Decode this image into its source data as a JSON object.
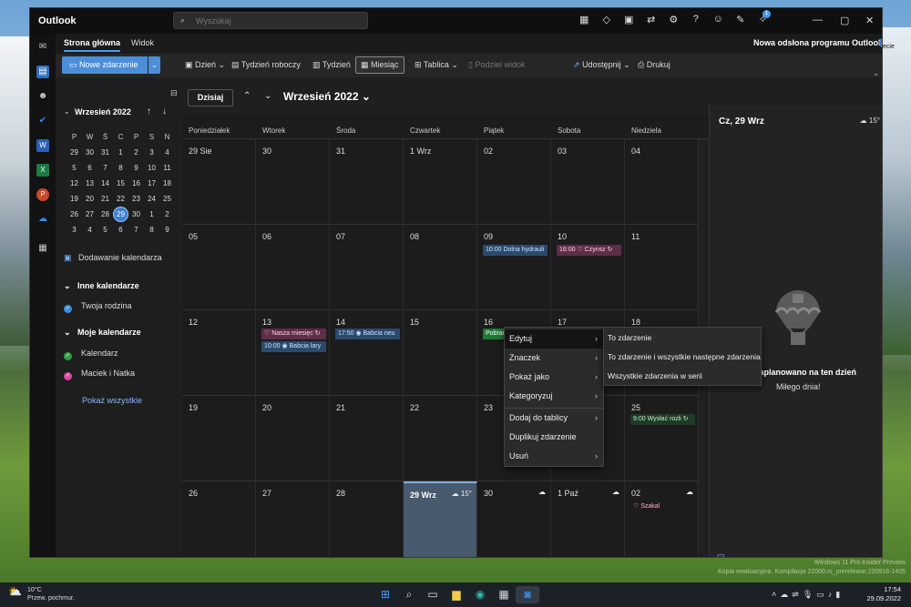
{
  "window": {
    "title": "Outlook"
  },
  "search": {
    "placeholder": "Wyszukaj",
    "icon": "search-icon"
  },
  "titlebar": {
    "badge": "1"
  },
  "ribbon": {
    "tabs": [
      "Strona główna",
      "Widok"
    ],
    "new_outlook_label": "Nowa odsłona programu Outlook",
    "edge_text": "ecie"
  },
  "toolbar": {
    "new_event": "Nowe zdarzenie",
    "day": "Dzień",
    "work_week": "Tydzień roboczy",
    "week": "Tydzień",
    "month": "Miesiąc",
    "board": "Tablica",
    "split": "Podziel widok",
    "share": "Udostępnij",
    "print": "Drukuj"
  },
  "sidebar": {
    "mini_month": "Wrzesień 2022",
    "weekdays": [
      "P",
      "W",
      "Ś",
      "C",
      "P",
      "S",
      "N"
    ],
    "weeks": [
      [
        "29",
        "30",
        "31",
        "1",
        "2",
        "3",
        "4"
      ],
      [
        "5",
        "6",
        "7",
        "8",
        "9",
        "10",
        "11"
      ],
      [
        "12",
        "13",
        "14",
        "15",
        "16",
        "17",
        "18"
      ],
      [
        "19",
        "20",
        "21",
        "22",
        "23",
        "24",
        "25"
      ],
      [
        "26",
        "27",
        "28",
        "29",
        "30",
        "1",
        "2"
      ],
      [
        "3",
        "4",
        "5",
        "6",
        "7",
        "8",
        "9"
      ]
    ],
    "add_calendar": "Dodawanie kalendarza",
    "other_calendars": "Inne kalendarze",
    "family": "Twoja rodzina",
    "my_calendars": "Moje kalendarze",
    "calendar": "Kalendarz",
    "maciek": "Maciek i Natka",
    "show_all": "Pokaż wszystkie"
  },
  "calendar": {
    "today_button": "Dzisiaj",
    "month_title": "Wrzesień 2022",
    "days_of_week": [
      "Poniedziałek",
      "Wtorek",
      "Środa",
      "Czwartek",
      "Piątek",
      "Sobota",
      "Niedziela"
    ],
    "weeks": [
      [
        "29 Sie",
        "30",
        "31",
        "1 Wrz",
        "02",
        "03",
        "04"
      ],
      [
        "05",
        "06",
        "07",
        "08",
        "09",
        "10",
        "11"
      ],
      [
        "12",
        "13",
        "14",
        "15",
        "16",
        "17",
        "18"
      ],
      [
        "19",
        "20",
        "21",
        "22",
        "23",
        "24",
        "25"
      ],
      [
        "26",
        "27",
        "28",
        "29 Wrz",
        "30",
        "1 Paź",
        "02"
      ]
    ],
    "today_temp": "15°",
    "events": {
      "dolna": "10:00 Dolna hydrauli",
      "czynsz": "16:00 ♡ Czynsz ↻",
      "nasza": "♡ Nasza miesięc ↻",
      "babcia_lary": "10:00 ◉ Babcia lary",
      "babcia_neu": "17:50 ◉ Babcia neu",
      "pobrac": "Pobrać … ↻",
      "wyslac": "9:00 Wysłać rozli ↻",
      "szakal": "♡ Szakal"
    }
  },
  "agenda": {
    "date": "Cz, 29 Wrz",
    "temp": "15°",
    "empty": "zaplanowano na ten dzień",
    "sub": "Miłego dnia!"
  },
  "context_menu": {
    "items": [
      "Edytuj",
      "Znaczek",
      "Pokaż jako",
      "Kategoryzuj",
      "Dodaj do tablicy",
      "Duplikuj zdarzenie",
      "Usuń"
    ],
    "submenu": [
      "To zdarzenie",
      "To zdarzenie i wszystkie następne zdarzenia",
      "Wszystkie zdarzenia w serii"
    ]
  },
  "taskbar": {
    "temp": "10°C",
    "weather": "Przew. pochmur.",
    "time": "17:54",
    "date": "29.09.2022"
  },
  "watermark": {
    "line1": "Windows 11 Pro Insider Preview",
    "line2": "Kopia ewaluacyjna. Kompilacja 22000.rs_prerelease.220916-1405"
  }
}
